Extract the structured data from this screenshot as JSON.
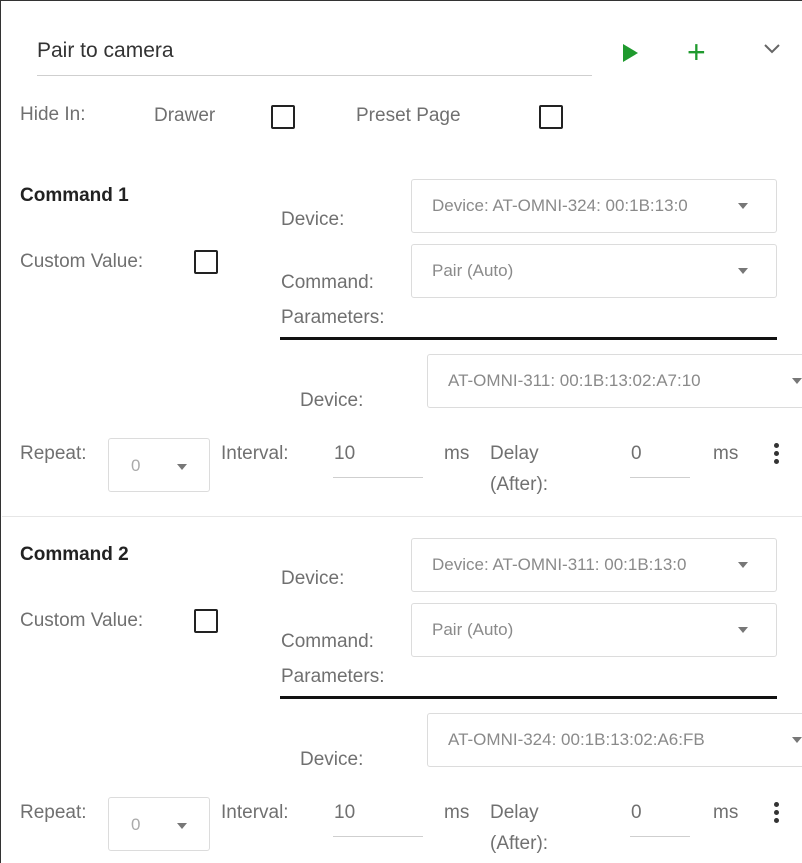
{
  "header": {
    "title": "Pair to camera"
  },
  "hide_in": {
    "label": "Hide In:",
    "drawer_label": "Drawer",
    "preset_label": "Preset Page"
  },
  "commands": [
    {
      "heading": "Command 1",
      "custom_value_label": "Custom Value:",
      "device_label": "Device:",
      "device_value": "Device: AT-OMNI-324: 00:1B:13:0",
      "command_label": "Command:",
      "command_value": "Pair (Auto)",
      "parameters_label": "Parameters:",
      "param_device_label": "Device:",
      "param_device_value": "AT-OMNI-311: 00:1B:13:02:A7:10",
      "repeat_label": "Repeat:",
      "repeat_value": "0",
      "interval_label": "Interval:",
      "interval_value": "10",
      "interval_unit": "ms",
      "delay_label_1": "Delay",
      "delay_label_2": "(After):",
      "delay_value": "0",
      "delay_unit": "ms"
    },
    {
      "heading": "Command 2",
      "custom_value_label": "Custom Value:",
      "device_label": "Device:",
      "device_value": "Device: AT-OMNI-311: 00:1B:13:0",
      "command_label": "Command:",
      "command_value": "Pair (Auto)",
      "parameters_label": "Parameters:",
      "param_device_label": "Device:",
      "param_device_value": "AT-OMNI-324: 00:1B:13:02:A6:FB",
      "repeat_label": "Repeat:",
      "repeat_value": "0",
      "interval_label": "Interval:",
      "interval_value": "10",
      "interval_unit": "ms",
      "delay_label_1": "Delay",
      "delay_label_2": "(After):",
      "delay_value": "0",
      "delay_unit": "ms"
    }
  ],
  "colors": {
    "accent_green": "#1f9a2e",
    "text": "#707070",
    "border": "#dcdcdc"
  },
  "icons": [
    "play-icon",
    "plus-icon",
    "chevron-down-icon",
    "kebab-menu-icon",
    "caret-down-icon"
  ]
}
